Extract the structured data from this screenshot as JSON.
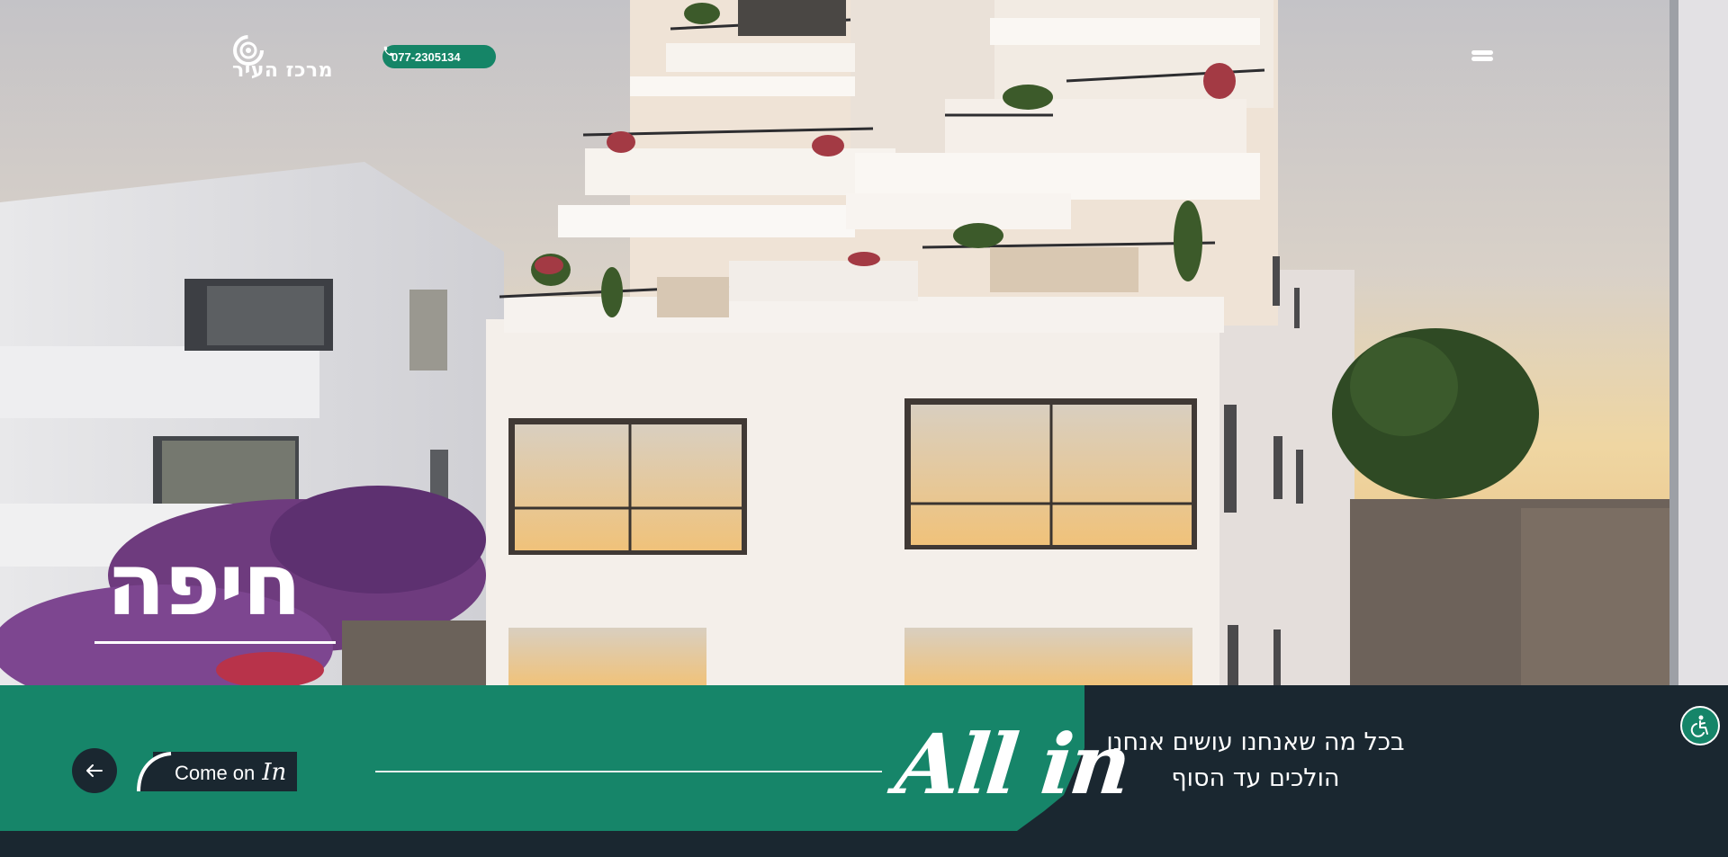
{
  "header": {
    "logo_text": "מרכז העיר",
    "phone": "077-2305134",
    "icons": {
      "phone": "phone-icon",
      "menu": "hamburger-menu-icon",
      "logo": "target-logo-icon"
    }
  },
  "hero": {
    "city_title": "חיפה",
    "image_description_icon": "building-render"
  },
  "footer_bar": {
    "cta_label": "Come on",
    "cta_script": "In",
    "brand_tagline": "All in",
    "slogan_line1": "בכל מה שאנחנו עושים אנחנו",
    "slogan_line2": "הולכים עד הסוף",
    "icons": {
      "back": "arrow-left-icon",
      "accessibility": "accessibility-icon"
    }
  },
  "colors": {
    "brand_green": "#168569",
    "dark_navy": "#1a2730",
    "white": "#ffffff"
  }
}
